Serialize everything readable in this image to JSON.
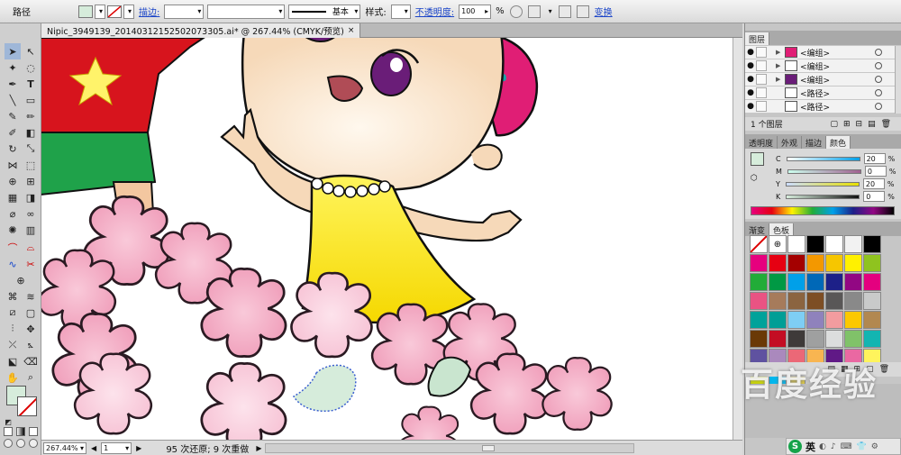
{
  "control_bar": {
    "mode_label": "路径",
    "stroke_label": "描边:",
    "stroke_profile_label": "基本",
    "style_label": "样式:",
    "opacity_label": "不透明度:",
    "opacity_value": "100",
    "opacity_unit": "%",
    "transform_label": "变换"
  },
  "document": {
    "tab_title": "Nipic_3949139_20140312152502073305.ai* @ 267.44% (CMYK/预览)",
    "close_glyph": "×"
  },
  "status": {
    "zoom": "267.44%",
    "artboard": "1",
    "undo_info": "95 次还原; 9 次重做"
  },
  "layers_panel": {
    "tab": "图层",
    "rows": [
      {
        "label": "<编组>"
      },
      {
        "label": "<编组>"
      },
      {
        "label": "<编组>"
      },
      {
        "label": "<路径>"
      },
      {
        "label": "<路径>"
      }
    ],
    "footer": "1 个图层"
  },
  "color_panel": {
    "tabs": [
      "透明度",
      "外观",
      "描边",
      "颜色"
    ],
    "sliders": [
      {
        "channel": "C",
        "value": "20",
        "unit": "%"
      },
      {
        "channel": "M",
        "value": "0",
        "unit": "%"
      },
      {
        "channel": "Y",
        "value": "20",
        "unit": "%"
      },
      {
        "channel": "K",
        "value": "0",
        "unit": "%"
      }
    ]
  },
  "swatches_panel": {
    "tabs": [
      "渐变",
      "色板"
    ],
    "colors": [
      "#ffffff",
      "#f2f2f2",
      "#000000",
      "#e6007e",
      "#e60012",
      "#a40000",
      "#f39800",
      "#f6c600",
      "#fff100",
      "#8fc31f",
      "#22ac38",
      "#009944",
      "#00a0e9",
      "#0068b7",
      "#1d2088",
      "#920783",
      "#e4007f",
      "#e95383",
      "#a67b5b",
      "#8b6440",
      "#7d4e24",
      "#595757",
      "#898989",
      "#c9caca",
      "#00a29a",
      "#009e96",
      "#7ecef4",
      "#8f82bc",
      "#f29c9f",
      "#fcc800",
      "#b28850",
      "#6a3906",
      "#c30d23",
      "#3e3a39",
      "#9fa0a0",
      "#dcdddd",
      "#80c269",
      "#13b5b1",
      "#5f52a0",
      "#aa89bd",
      "#eb6877",
      "#f8b551",
      "#601986",
      "#ea68a2",
      "#fff45c",
      "#cfdb00",
      "#00b7ee",
      "#d7c447"
    ]
  },
  "ime": {
    "logo": "S",
    "lang": "英"
  },
  "watermark": "百度经验",
  "colors": {
    "fill_swatch": "#d6ecdb",
    "accent_link": "#1a44c8"
  }
}
